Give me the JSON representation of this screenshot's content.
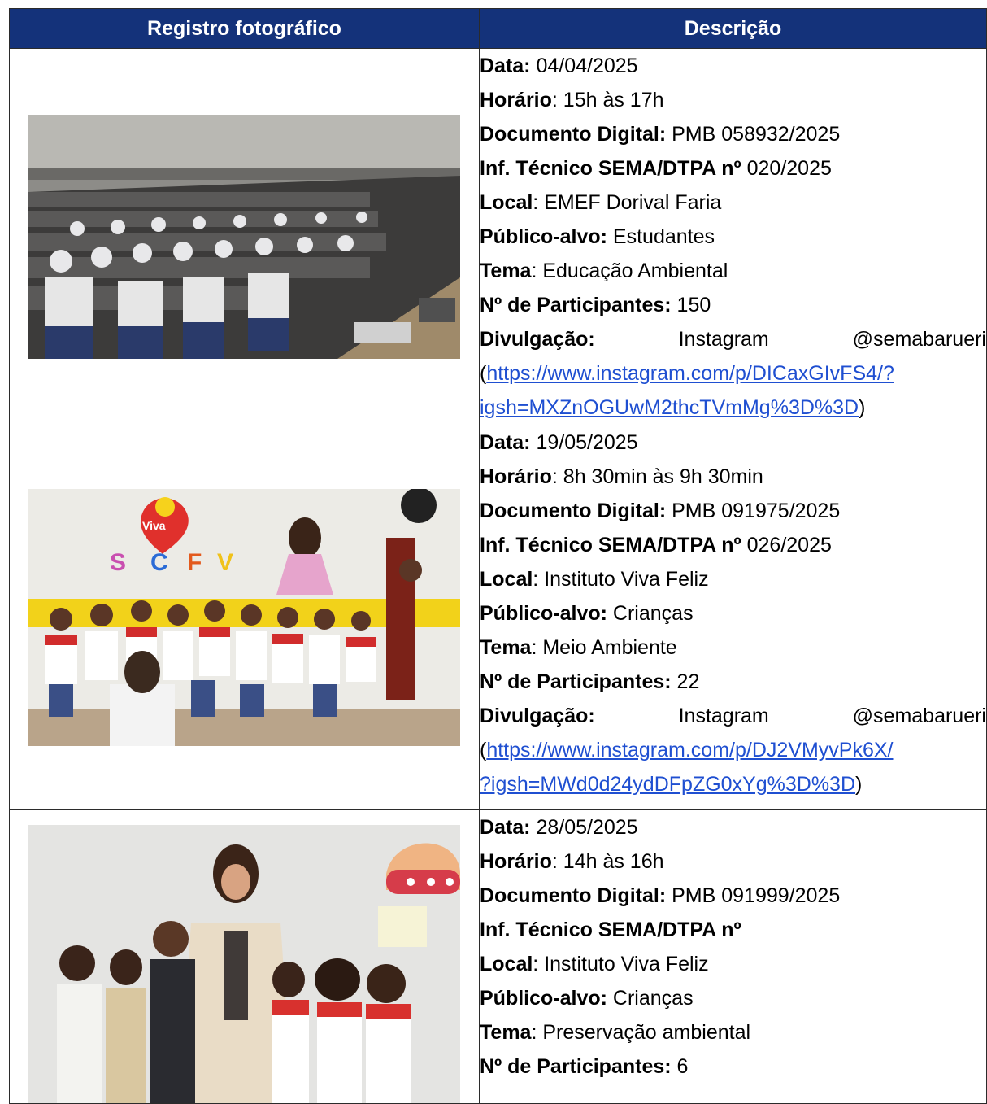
{
  "header": {
    "col_photo": "Registro fotográfico",
    "col_desc": "Descrição"
  },
  "records": [
    {
      "date_label": "Data:",
      "date": "04/04/2025",
      "time_label": "Horário",
      "time": ": 15h às 17h",
      "doc_label": "Documento Digital:",
      "doc": "PMB 058932/2025",
      "inf_label": "Inf. Técnico SEMA/DTPA nº",
      "inf": "020/2025",
      "local_label": "Local",
      "local": ": EMEF Dorival Faria",
      "publico_label": "Público-alvo:",
      "publico": "Estudantes",
      "tema_label": "Tema",
      "tema": ": Educação Ambiental",
      "part_label": "Nº de Participantes:",
      "part": "150",
      "div_label": "Divulgação:",
      "div_platform": "Instagram",
      "div_handle": "@semabarueri",
      "link_line1": "https://www.instagram.com/p/DICaxGIvFS4/?",
      "link_line2": "igsh=MXZnOGUwM2thcTVmMg%3D%3D",
      "photo_desc": "auditorium-students"
    },
    {
      "date_label": "Data:",
      "date": "19/05/2025",
      "time_label": "Horário",
      "time": ": 8h 30min às 9h 30min",
      "doc_label": "Documento Digital:",
      "doc": "PMB 091975/2025",
      "inf_label": "Inf. Técnico SEMA/DTPA nº",
      "inf": "026/2025",
      "local_label": "Local",
      "local": ": Instituto Viva Feliz",
      "publico_label": "Público-alvo:",
      "publico": "Crianças",
      "tema_label": "Tema",
      "tema": ": Meio Ambiente",
      "part_label": "Nº de Participantes:",
      "part": "22",
      "div_label": "Divulgação:",
      "div_platform": "Instagram",
      "div_handle": "@semabarueri",
      "link_line1": "https://www.instagram.com/p/DJ2VMyvPk6X/",
      "link_line2": "?igsh=MWd0d24ydDFpZG0xYg%3D%3D",
      "photo_desc": "children-group-viva-feliz"
    },
    {
      "date_label": "Data:",
      "date": "28/05/2025",
      "time_label": "Horário",
      "time": ": 14h às 16h",
      "doc_label": "Documento Digital:",
      "doc": "PMB 091999/2025",
      "inf_label": "Inf. Técnico SEMA/DTPA nº",
      "inf": "",
      "local_label": "Local",
      "local": ": Instituto Viva Feliz",
      "publico_label": "Público-alvo:",
      "publico": "Crianças",
      "tema_label": "Tema",
      "tema": ": Preservação ambiental",
      "part_label": "Nº de Participantes:",
      "part": "6",
      "photo_desc": "children-with-teacher"
    }
  ],
  "colors": {
    "header_bg": "#14327a",
    "header_text": "#ffffff",
    "link": "#1f4fd1",
    "border": "#2b2b2b"
  }
}
